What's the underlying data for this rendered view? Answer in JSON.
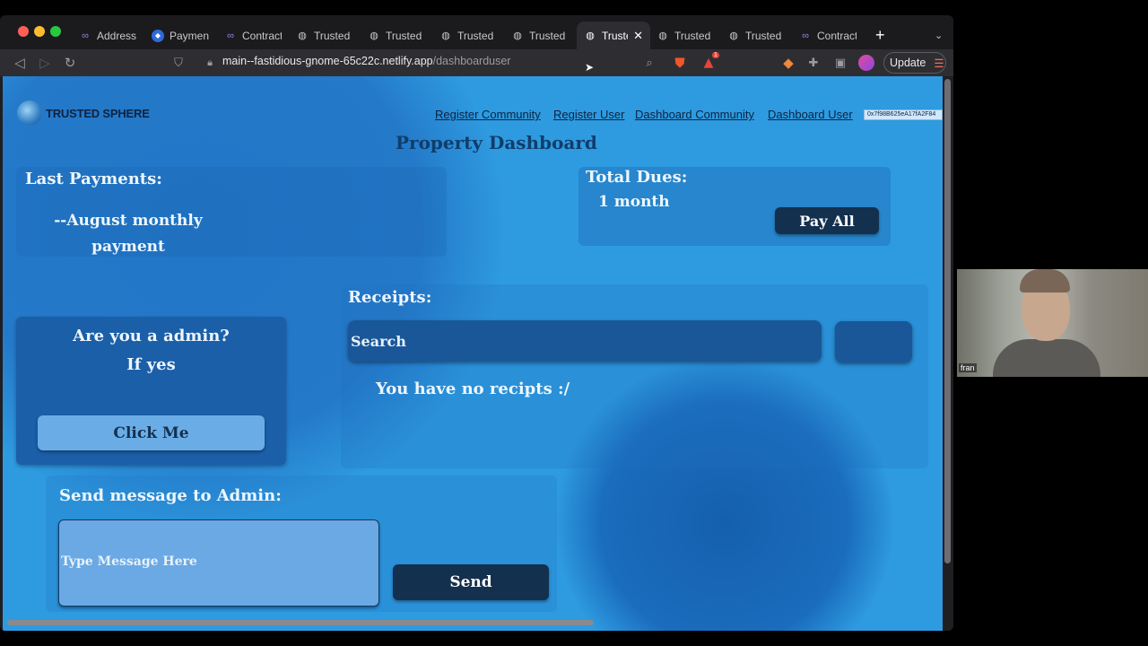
{
  "browser": {
    "tabs": [
      {
        "label": "Address (",
        "icon": "link-icon"
      },
      {
        "label": "Payment",
        "icon": "app-icon"
      },
      {
        "label": "Contract",
        "icon": "link-icon"
      },
      {
        "label": "Trusted S",
        "icon": "globe-icon"
      },
      {
        "label": "Trusted S",
        "icon": "globe-icon"
      },
      {
        "label": "Trusted S",
        "icon": "globe-icon"
      },
      {
        "label": "Trusted S",
        "icon": "globe-icon"
      },
      {
        "label": "Truste",
        "icon": "globe-icon"
      },
      {
        "label": "Trusted S",
        "icon": "globe-icon"
      },
      {
        "label": "Trusted S",
        "icon": "globe-icon"
      },
      {
        "label": "Contract",
        "icon": "link-icon"
      }
    ],
    "url_host": "main--fastidious-gnome-65c22c.netlify.app",
    "url_path": "/dashboarduser",
    "update_label": "Update",
    "notification_count": "1"
  },
  "header": {
    "logo_text": "TRUSTED SPHERE",
    "nav": {
      "register_community": "Register Community",
      "register_user": "Register User",
      "dashboard_community": "Dashboard Community",
      "dashboard_user": "Dashboard User"
    },
    "wallet_address": "0x7f98B625eA17fA2F84"
  },
  "page": {
    "title": "Property Dashboard"
  },
  "last_payments": {
    "heading": "Last Payments:",
    "item_line1": "--August monthly",
    "item_line2": "payment"
  },
  "dues": {
    "heading": "Total Dues:",
    "value": "1 month",
    "pay_all_label": "Pay All"
  },
  "admin": {
    "question_line1": "Are you a admin?",
    "question_line2": "If yes",
    "click_label": "Click Me"
  },
  "receipts": {
    "heading": "Receipts:",
    "search_placeholder": "Search",
    "empty_text": "You have no recipts :/"
  },
  "message": {
    "heading": "Send message to Admin:",
    "placeholder": "Type Message Here",
    "send_label": "Send"
  },
  "webcam": {
    "name": "fran"
  },
  "colors": {
    "page_bg": "#2e9be0",
    "dark_button": "#14304f",
    "light_button": "#6aade6"
  }
}
